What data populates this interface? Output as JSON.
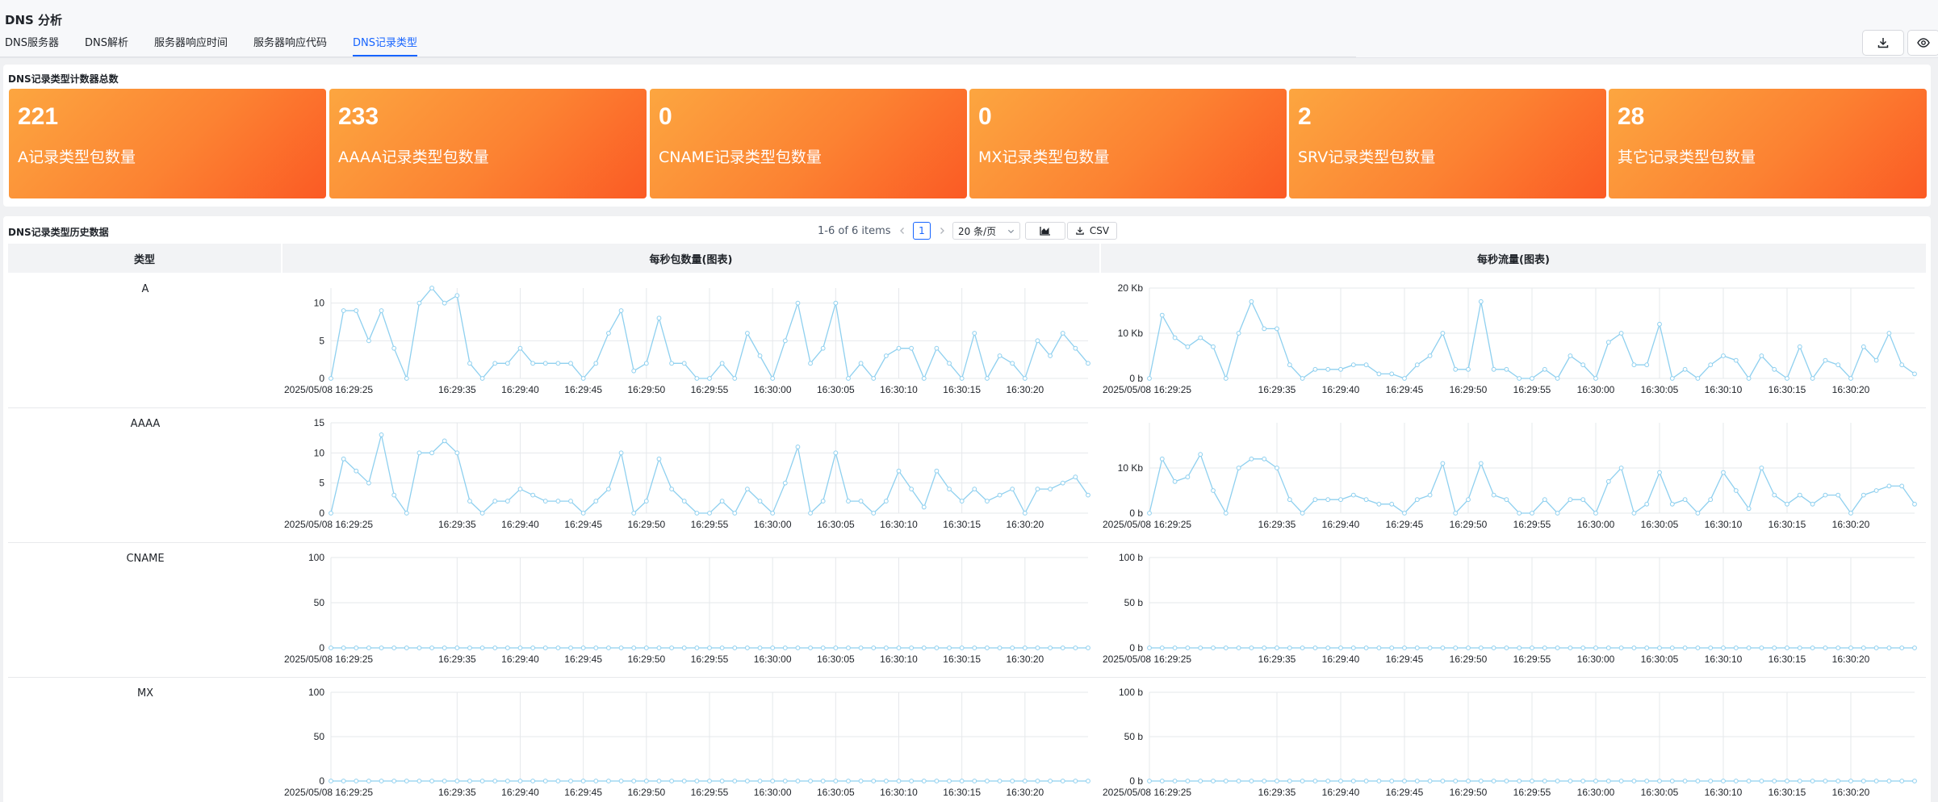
{
  "header": {
    "title": "DNS 分析",
    "tabs": [
      {
        "label": "DNS服务器",
        "active": false
      },
      {
        "label": "DNS解析",
        "active": false
      },
      {
        "label": "服务器响应时间",
        "active": false
      },
      {
        "label": "服务器响应代码",
        "active": false
      },
      {
        "label": "DNS记录类型",
        "active": true
      }
    ],
    "download_icon": "download-icon",
    "view_icon": "eye-icon"
  },
  "counters": {
    "title": "DNS记录类型计数器总数",
    "cards": [
      {
        "value": "221",
        "label": "A记录类型包数量"
      },
      {
        "value": "233",
        "label": "AAAA记录类型包数量"
      },
      {
        "value": "0",
        "label": "CNAME记录类型包数量"
      },
      {
        "value": "0",
        "label": "MX记录类型包数量"
      },
      {
        "value": "2",
        "label": "SRV记录类型包数量"
      },
      {
        "value": "28",
        "label": "其它记录类型包数量"
      }
    ]
  },
  "history": {
    "title": "DNS记录类型历史数据",
    "pagination": {
      "summary": "1-6 of 6 items",
      "current_page": "1",
      "page_size": "20 条/页",
      "csv_label": "CSV"
    },
    "columns": [
      "类型",
      "每秒包数量(图表)",
      "每秒流量(图表)"
    ],
    "x_tick_labels": [
      "2025/05/08 16:29:25",
      "16:29:35",
      "16:29:40",
      "16:29:45",
      "16:29:50",
      "16:29:55",
      "16:30:00",
      "16:30:05",
      "16:30:10",
      "16:30:15",
      "16:30:20"
    ],
    "rows": [
      {
        "type": "A"
      },
      {
        "type": "AAAA"
      },
      {
        "type": "CNAME"
      },
      {
        "type": "MX"
      }
    ]
  },
  "colors": {
    "accent": "#1664ff",
    "line": "#8fd0ef",
    "card_start": "#fca640",
    "card_end": "#fb5a24"
  },
  "chart_data": [
    {
      "type": "line",
      "name": "A 每秒包数量",
      "ylim": [
        0,
        12
      ],
      "y_ticks": [
        "0",
        "5",
        "10"
      ],
      "x_range": [
        "16:29:25",
        "16:30:24"
      ],
      "values": [
        0,
        9,
        9,
        5,
        9,
        4,
        0,
        10,
        12,
        10,
        11,
        2,
        0,
        2,
        2,
        4,
        2,
        2,
        2,
        2,
        0,
        2,
        6,
        9,
        1,
        2,
        8,
        2,
        2,
        0,
        0,
        2,
        0,
        6,
        3,
        0,
        5,
        10,
        2,
        4,
        10,
        0,
        2,
        0,
        3,
        4,
        4,
        0,
        4,
        2,
        0,
        6,
        0,
        3,
        2,
        0,
        5,
        3,
        6,
        4,
        2
      ]
    },
    {
      "type": "line",
      "name": "A 每秒流量",
      "ylim": [
        0,
        20
      ],
      "y_ticks": [
        "0 b",
        "10 Kb",
        "20 Kb"
      ],
      "x_range": [
        "16:29:25",
        "16:30:24"
      ],
      "values": [
        0,
        14,
        9,
        7,
        9,
        7,
        0,
        10,
        17,
        11,
        11,
        3,
        0,
        2,
        2,
        2,
        3,
        3,
        1,
        1,
        0,
        3,
        5,
        10,
        2,
        2,
        17,
        2,
        2,
        0,
        0,
        2,
        0,
        5,
        3,
        0,
        8,
        10,
        3,
        3,
        12,
        0,
        2,
        0,
        3,
        5,
        4,
        0,
        5,
        2,
        0,
        7,
        0,
        4,
        3,
        0,
        7,
        4,
        10,
        3,
        1
      ]
    },
    {
      "type": "line",
      "name": "AAAA 每秒包数量",
      "ylim": [
        0,
        15
      ],
      "y_ticks": [
        "0",
        "5",
        "10",
        "15"
      ],
      "x_range": [
        "16:29:25",
        "16:30:24"
      ],
      "values": [
        0,
        9,
        7,
        5,
        13,
        3,
        0,
        10,
        10,
        12,
        10,
        2,
        0,
        2,
        2,
        4,
        3,
        2,
        2,
        2,
        0,
        2,
        4,
        10,
        0,
        2,
        9,
        4,
        2,
        0,
        0,
        2,
        0,
        4,
        2,
        0,
        5,
        11,
        0,
        2,
        10,
        2,
        2,
        0,
        2,
        7,
        4,
        1,
        7,
        4,
        2,
        4,
        2,
        3,
        4,
        0,
        4,
        4,
        5,
        6,
        3
      ]
    },
    {
      "type": "line",
      "name": "AAAA 每秒流量",
      "ylim": [
        0,
        20
      ],
      "y_ticks": [
        "0 b",
        "10 Kb"
      ],
      "x_range": [
        "16:29:25",
        "16:30:24"
      ],
      "values": [
        0,
        12,
        7,
        8,
        13,
        5,
        0,
        10,
        12,
        12,
        10,
        3,
        0,
        3,
        3,
        3,
        4,
        3,
        2,
        2,
        0,
        3,
        4,
        11,
        0,
        3,
        11,
        4,
        3,
        0,
        0,
        3,
        0,
        3,
        3,
        0,
        7,
        10,
        0,
        2,
        9,
        2,
        3,
        0,
        3,
        9,
        5,
        1,
        10,
        4,
        2,
        4,
        2,
        4,
        4,
        0,
        4,
        5,
        6,
        6,
        2
      ]
    },
    {
      "type": "line",
      "name": "CNAME 每秒包数量",
      "ylim": [
        0,
        100
      ],
      "y_ticks": [
        "0",
        "50",
        "100"
      ],
      "x_range": [
        "16:29:25",
        "16:30:24"
      ],
      "values": [
        0,
        0,
        0,
        0,
        0,
        0,
        0,
        0,
        0,
        0,
        0,
        0,
        0,
        0,
        0,
        0,
        0,
        0,
        0,
        0,
        0,
        0,
        0,
        0,
        0,
        0,
        0,
        0,
        0,
        0,
        0,
        0,
        0,
        0,
        0,
        0,
        0,
        0,
        0,
        0,
        0,
        0,
        0,
        0,
        0,
        0,
        0,
        0,
        0,
        0,
        0,
        0,
        0,
        0,
        0,
        0,
        0,
        0,
        0,
        0,
        0
      ]
    },
    {
      "type": "line",
      "name": "CNAME 每秒流量",
      "ylim": [
        0,
        100
      ],
      "y_ticks": [
        "0 b",
        "50 b",
        "100 b"
      ],
      "x_range": [
        "16:29:25",
        "16:30:24"
      ],
      "values": [
        0,
        0,
        0,
        0,
        0,
        0,
        0,
        0,
        0,
        0,
        0,
        0,
        0,
        0,
        0,
        0,
        0,
        0,
        0,
        0,
        0,
        0,
        0,
        0,
        0,
        0,
        0,
        0,
        0,
        0,
        0,
        0,
        0,
        0,
        0,
        0,
        0,
        0,
        0,
        0,
        0,
        0,
        0,
        0,
        0,
        0,
        0,
        0,
        0,
        0,
        0,
        0,
        0,
        0,
        0,
        0,
        0,
        0,
        0,
        0,
        0
      ]
    },
    {
      "type": "line",
      "name": "MX 每秒包数量",
      "ylim": [
        0,
        100
      ],
      "y_ticks": [
        "0",
        "50",
        "100"
      ],
      "x_range": [
        "16:29:25",
        "16:30:24"
      ],
      "values": [
        0,
        0,
        0,
        0,
        0,
        0,
        0,
        0,
        0,
        0,
        0,
        0,
        0,
        0,
        0,
        0,
        0,
        0,
        0,
        0,
        0,
        0,
        0,
        0,
        0,
        0,
        0,
        0,
        0,
        0,
        0,
        0,
        0,
        0,
        0,
        0,
        0,
        0,
        0,
        0,
        0,
        0,
        0,
        0,
        0,
        0,
        0,
        0,
        0,
        0,
        0,
        0,
        0,
        0,
        0,
        0,
        0,
        0,
        0,
        0,
        0
      ]
    },
    {
      "type": "line",
      "name": "MX 每秒流量",
      "ylim": [
        0,
        100
      ],
      "y_ticks": [
        "0 b",
        "50 b",
        "100 b"
      ],
      "x_range": [
        "16:29:25",
        "16:30:24"
      ],
      "values": [
        0,
        0,
        0,
        0,
        0,
        0,
        0,
        0,
        0,
        0,
        0,
        0,
        0,
        0,
        0,
        0,
        0,
        0,
        0,
        0,
        0,
        0,
        0,
        0,
        0,
        0,
        0,
        0,
        0,
        0,
        0,
        0,
        0,
        0,
        0,
        0,
        0,
        0,
        0,
        0,
        0,
        0,
        0,
        0,
        0,
        0,
        0,
        0,
        0,
        0,
        0,
        0,
        0,
        0,
        0,
        0,
        0,
        0,
        0,
        0,
        0
      ]
    }
  ]
}
